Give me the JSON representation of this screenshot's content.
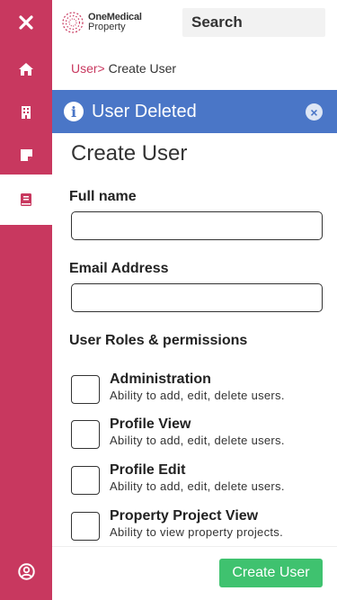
{
  "colors": {
    "sidebar": "#c8385f",
    "alert": "#4a76c7",
    "primary_button": "#3fc26f",
    "breadcrumb_link": "#c8385f"
  },
  "sidebar": {
    "items": [
      {
        "icon": "close-icon"
      },
      {
        "icon": "home-icon"
      },
      {
        "icon": "building-icon"
      },
      {
        "icon": "note-icon"
      },
      {
        "icon": "book-icon",
        "active": true
      },
      {
        "icon": "user-circle-icon"
      }
    ]
  },
  "header": {
    "logo_line1": "OneMedical",
    "logo_line2": "Property",
    "search_label": "Search"
  },
  "breadcrumb": {
    "parent": "User>",
    "current": "Create User"
  },
  "alert": {
    "message": "User Deleted",
    "info_glyph": "i",
    "close_glyph": "×"
  },
  "page": {
    "title": "Create User"
  },
  "form": {
    "full_name_label": "Full name",
    "full_name_value": "",
    "email_label": "Email Address",
    "email_value": "",
    "roles_heading": "User Roles & permissions",
    "roles": [
      {
        "name": "Administration",
        "description": "Ability to add, edit, delete users."
      },
      {
        "name": "Profile View",
        "description": "Ability to add, edit, delete users."
      },
      {
        "name": "Profile Edit",
        "description": "Ability to add, edit, delete users."
      },
      {
        "name": "Property Project View",
        "description": "Ability to view property projects."
      }
    ],
    "submit_label": "Create User"
  }
}
